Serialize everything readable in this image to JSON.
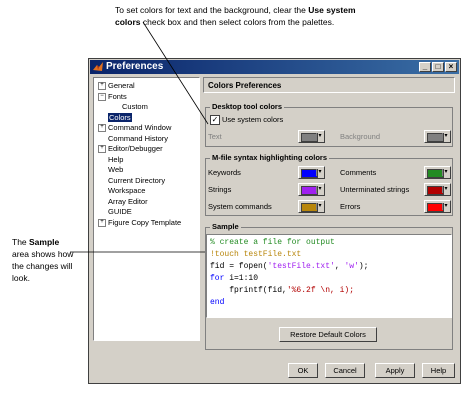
{
  "callouts": {
    "top_line1_pre": "To set colors for text and the background, clear the ",
    "top_line1_bold": "Use system",
    "top_line2_bold": "colors",
    "top_line2_post": " check box and then select colors from the palettes.",
    "left_l1_pre": "The ",
    "left_l1_bold": "Sample",
    "left_l2": "area shows how",
    "left_l3": "the changes will",
    "left_l4": "look."
  },
  "window": {
    "title": "Preferences",
    "min_glyph": "_",
    "max_glyph": "□",
    "close_glyph": "×"
  },
  "tree": {
    "items": [
      {
        "label": "General",
        "expander": "+"
      },
      {
        "label": "Fonts",
        "expander": "−"
      },
      {
        "label": "Custom",
        "expander": ""
      },
      {
        "label": "Colors",
        "expander": ""
      },
      {
        "label": "Command Window",
        "expander": "+"
      },
      {
        "label": "Command History",
        "expander": ""
      },
      {
        "label": "Editor/Debugger",
        "expander": "+"
      },
      {
        "label": "Help",
        "expander": ""
      },
      {
        "label": "Web",
        "expander": ""
      },
      {
        "label": "Current Directory",
        "expander": ""
      },
      {
        "label": "Workspace",
        "expander": ""
      },
      {
        "label": "Array Editor",
        "expander": ""
      },
      {
        "label": "GUIDE",
        "expander": ""
      },
      {
        "label": "Figure Copy Template",
        "expander": "+"
      }
    ],
    "selected": "Colors"
  },
  "panel": {
    "title": "Colors Preferences",
    "desktop_group": "Desktop tool colors",
    "use_system_label": "Use system colors",
    "use_system_checked": "✓",
    "text_label": "Text",
    "background_label": "Background",
    "mfile_group": "M-file syntax highlighting colors",
    "keywords_label": "Keywords",
    "strings_label": "Strings",
    "system_commands_label": "System commands",
    "comments_label": "Comments",
    "unterminated_label": "Unterminated strings",
    "errors_label": "Errors",
    "sample_group": "Sample",
    "dropdown_arrow": "▾",
    "colors": {
      "keywords": "#0000ff",
      "strings": "#a020f0",
      "system_commands": "#b8860b",
      "comments": "#228b22",
      "unterminated": "#b20000",
      "errors": "#ff0000",
      "text_disabled": "#808080",
      "background_disabled": "#808080",
      "selection": "#0a246a"
    }
  },
  "sample_code": {
    "line1": "% create a file for output",
    "line2": "!touch testFile.txt",
    "line3_a": "fid = fopen(",
    "line3_s1": "'testFile.txt'",
    "line3_b": ", ",
    "line3_s2": "'w'",
    "line3_c": ");",
    "line4_kw": "for",
    "line4_rest": " i=1:10",
    "line5_a": "    fprintf(fid,",
    "line5_s": "'%6.2f \\n, i);",
    "line6_kw": "end"
  },
  "buttons": {
    "restore": "Restore Default Colors",
    "ok": "OK",
    "cancel": "Cancel",
    "apply": "Apply",
    "help": "Help"
  }
}
